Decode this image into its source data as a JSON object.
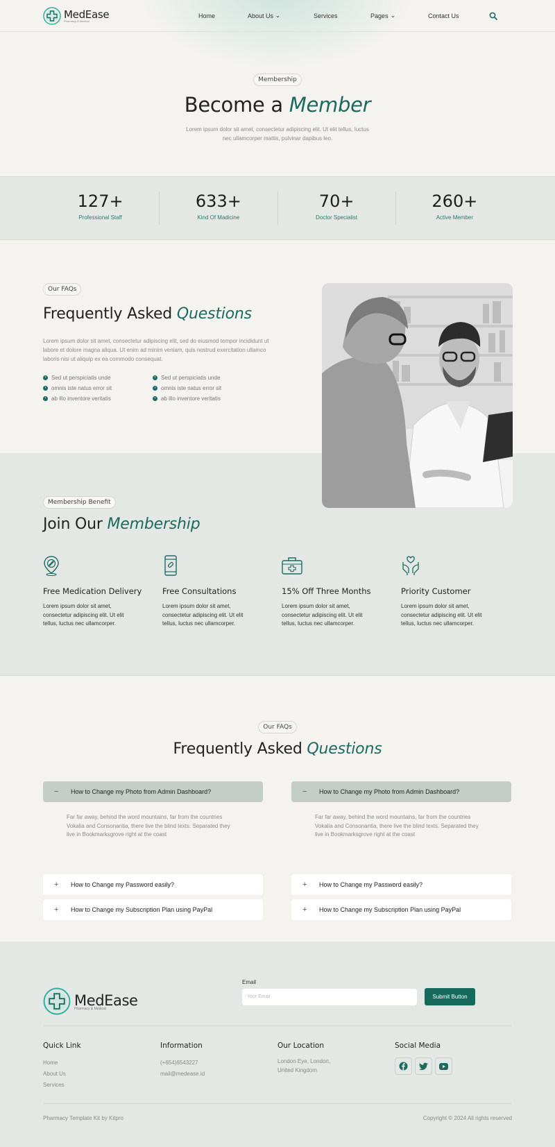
{
  "brand": {
    "name": "MedEase",
    "tagline": "Pharmacy & Medical"
  },
  "colors": {
    "accent": "#1b6a5e",
    "button": "#156a5b",
    "band": "#e4e8e5",
    "background": "#f4f3ef"
  },
  "nav": {
    "items": [
      {
        "label": "Home",
        "dropdown": false
      },
      {
        "label": "About Us",
        "dropdown": true
      },
      {
        "label": "Services",
        "dropdown": false
      },
      {
        "label": "Pages",
        "dropdown": true
      },
      {
        "label": "Contact Us",
        "dropdown": false
      }
    ],
    "search_icon": "search-icon"
  },
  "hero": {
    "badge": "Membership",
    "title_plain": "Become a",
    "title_accent": "Member",
    "text": "Lorem ipsum dolor sit amet, consectetur adipiscing elit. Ut elit tellus, luctus nec ullamcorper mattis, pulvinar dapibus leo."
  },
  "stats": [
    {
      "value": "127+",
      "label": "Professional Staff"
    },
    {
      "value": "633+",
      "label": "Kind Of Madicine"
    },
    {
      "value": "70+",
      "label": "Doctor Specialist"
    },
    {
      "value": "260+",
      "label": "Active Member"
    }
  ],
  "faq_intro": {
    "badge": "Our FAQs",
    "title_plain": "Frequently Asked",
    "title_accent": "Questions",
    "text": "Lorem ipsum dolor sit amet, consectetur adipiscing elit, sed do eiusmod tempor incididunt ut labore et dolore magna aliqua. Ut enim ad minim veniam, quis nostrud exercitation ullamco laboris nisi ut aliquip ex ea commodo consequat.",
    "checks": [
      "Sed ut perspiciatis unde",
      "Sed ut perspiciatis unde",
      "omnis iste natus error sit",
      "omnis iste natus error sit",
      "ab illo inventore veritatis",
      "ab illo inventore veritatis"
    ]
  },
  "membership": {
    "badge": "Membership Benefit",
    "title_plain": "Join Our",
    "title_accent": "Membership",
    "benefits": [
      {
        "icon": "location-pin-icon",
        "title": "Free Medication Delivery",
        "text": "Lorem ipsum dolor sit amet, consectetur adipiscing elit. Ut elit tellus, luctus nec ullamcorper."
      },
      {
        "icon": "mobile-pill-icon",
        "title": "Free Consultations",
        "text": "Lorem ipsum dolor sit amet, consectetur adipiscing elit. Ut elit tellus, luctus nec ullamcorper."
      },
      {
        "icon": "medical-kit-icon",
        "title": "15% Off Three Months",
        "text": "Lorem ipsum dolor sit amet, consectetur adipiscing elit. Ut elit tellus, luctus nec ullamcorper."
      },
      {
        "icon": "caring-hands-icon",
        "title": "Priority Customer",
        "text": "Lorem ipsum dolor sit amet, consectetur adipiscing elit. Ut elit tellus, luctus nec ullamcorper."
      }
    ]
  },
  "faq": {
    "badge": "Our FAQs",
    "title_plain": "Frequently Asked",
    "title_accent": "Questions",
    "columns": [
      {
        "open_q": "How to Change my Photo from Admin Dashboard?",
        "open_a": "Far far away, behind the word mountains, far from the countries Vokalia and Consonantia, there live the blind texts. Separated they live in Bookmarksgrove right at the coast",
        "q2": "How to Change my Password easily?",
        "q3": "How to Change my Subscription Plan using PayPal"
      },
      {
        "open_q": "How to Change my Photo from Admin Dashboard?",
        "open_a": "Far far away, behind the word mountains, far from the countries Vokalia and Consonantia, there live the blind texts. Separated they live in Bookmarksgrove right at the coast",
        "q2": "How to Change my Password easily?",
        "q3": "How to Change my Subscription Plan using PayPal"
      }
    ],
    "open_sign": "−",
    "closed_sign": "+"
  },
  "footer": {
    "email_label": "Email",
    "email_placeholder": "Your Email",
    "submit_label": "Submit Button",
    "quick_link": {
      "title": "Quick Link",
      "links": [
        "Home",
        "About Us",
        "Services"
      ]
    },
    "information": {
      "title": "Information",
      "phone": "(+654)6543227",
      "email": "mail@medease.id"
    },
    "location": {
      "title": "Our Location",
      "address": "London Eye, London, United Kingdom"
    },
    "social": {
      "title": "Social Media",
      "icons": [
        "facebook-icon",
        "twitter-icon",
        "youtube-icon"
      ]
    },
    "credit": "Pharmacy Template Kit by Kitpro",
    "copyright": "Copyright © 2024 All rights reserved"
  }
}
